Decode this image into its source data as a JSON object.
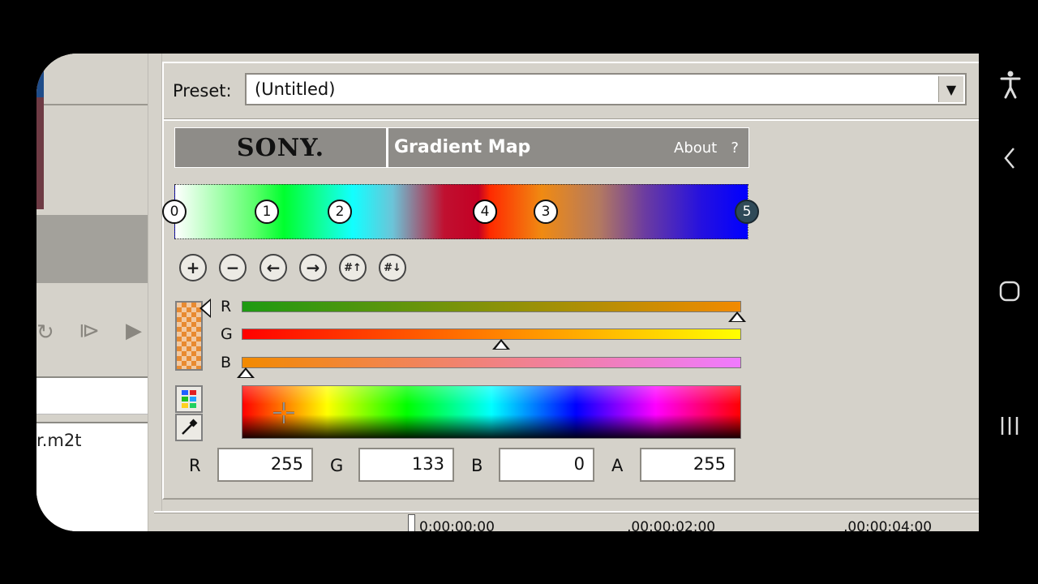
{
  "left_panel": {
    "file_name": "r.m2t"
  },
  "preset": {
    "label": "Preset:",
    "value": "(Untitled)"
  },
  "plugin": {
    "brand": "SONY.",
    "name": "Gradient Map",
    "about": "About",
    "help": "?"
  },
  "gradient_stops": [
    {
      "label": "0"
    },
    {
      "label": "1"
    },
    {
      "label": "2"
    },
    {
      "label": "4"
    },
    {
      "label": "3"
    },
    {
      "label": "5"
    }
  ],
  "tool_buttons": [
    "add-stop",
    "remove-stop",
    "move-left",
    "move-right",
    "distribute-up",
    "distribute-down"
  ],
  "channels": {
    "r_label": "R",
    "g_label": "G",
    "b_label": "B",
    "r_level": 1.0,
    "g_level": 0.52,
    "b_level": 0.0
  },
  "values": {
    "r_label": "R",
    "r": "255",
    "g_label": "G",
    "g": "133",
    "b_label": "B",
    "b": "0",
    "a_label": "A",
    "a": "255"
  },
  "timeline": {
    "t0": "0:00:00:00",
    "t1": ",00:00:02:00",
    "t2": ",00:00:04:00"
  },
  "colors": {
    "selected_color": "#ff8500"
  }
}
